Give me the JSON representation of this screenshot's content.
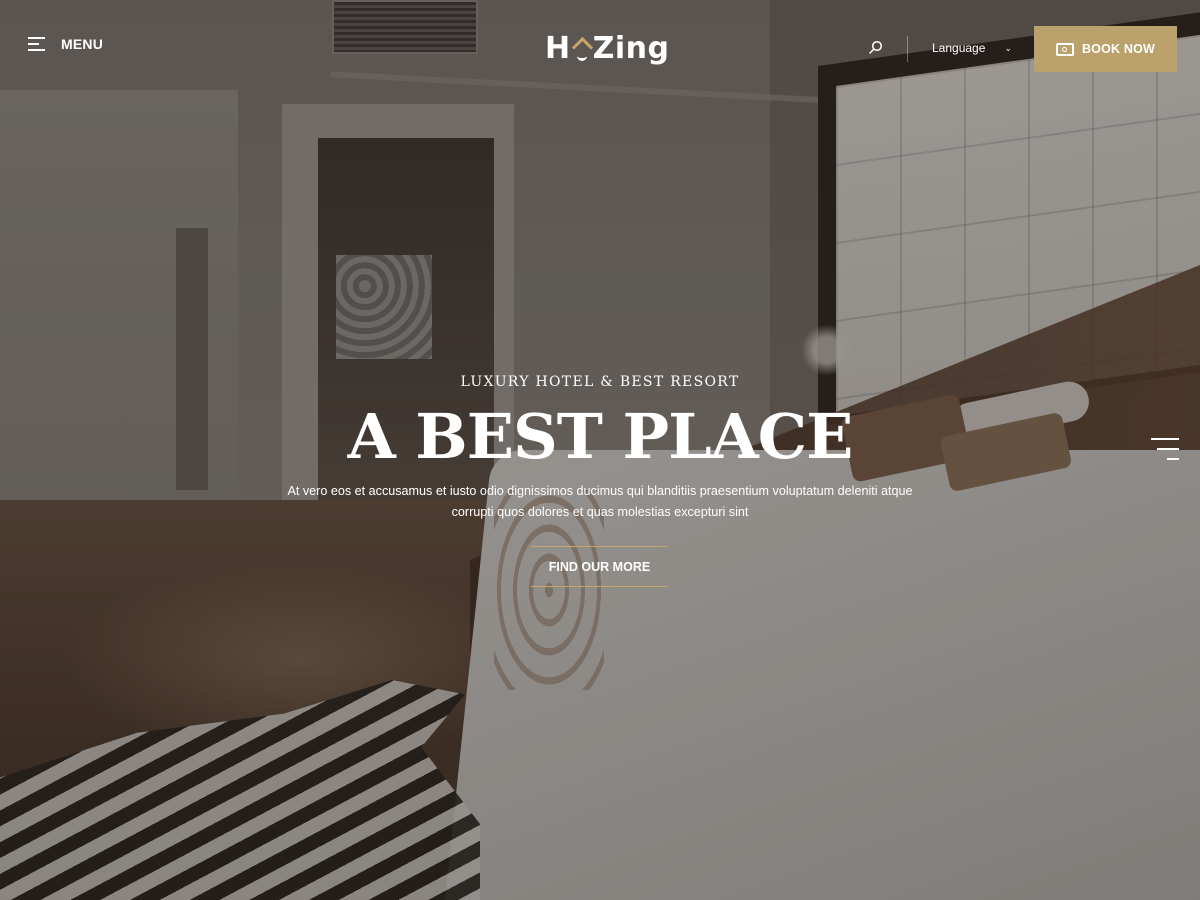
{
  "header": {
    "menu_label": "MENU",
    "logo": {
      "part1": "H",
      "part2": "Zing"
    },
    "language_label": "Language",
    "book_label": "BOOK NOW"
  },
  "hero": {
    "subtitle": "LUXURY HOTEL & BEST RESORT",
    "title": "A BEST PLACE",
    "description": "At vero eos et accusamus et iusto odio dignissimos ducimus qui blanditiis praesentium voluptatum deleniti atque corrupti quos dolores et quas molestias excepturi sint",
    "cta_label": "FIND OUR MORE"
  },
  "icons": {
    "menu": "hamburger-icon",
    "search": "search-icon",
    "language_dropdown": "chevron-down-icon",
    "book": "ticket-icon",
    "side_nav": "hamburger-icon"
  },
  "colors": {
    "accent": "#bba16c",
    "text": "#ffffff"
  }
}
